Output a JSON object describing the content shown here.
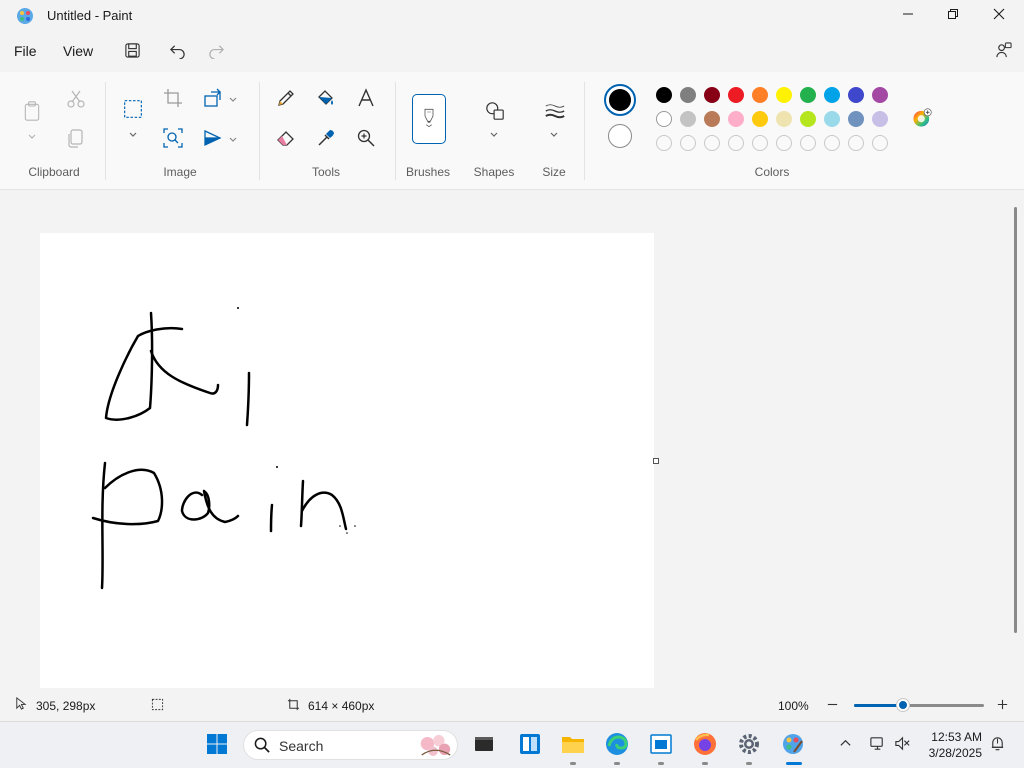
{
  "window": {
    "title": "Untitled - Paint",
    "minimize_icon": "minimize-icon",
    "restore_icon": "restore-icon",
    "close_icon": "close-icon"
  },
  "menu": {
    "file": "File",
    "view": "View",
    "icons": [
      "save-icon",
      "undo-icon",
      "redo-icon",
      "share-icon"
    ]
  },
  "ribbon": {
    "groups": {
      "clipboard": "Clipboard",
      "image": "Image",
      "tools": "Tools",
      "brushes": "Brushes",
      "shapes": "Shapes",
      "size": "Size",
      "colors": "Colors"
    },
    "tools": [
      "paste-icon",
      "cut-icon",
      "copy-icon",
      "select-icon",
      "crop-icon",
      "resize-icon",
      "rotate-icon",
      "image-search-icon",
      "flip-icon",
      "pencil-icon",
      "fill-icon",
      "text-icon",
      "eraser-icon",
      "color-picker-icon",
      "magnifier-icon",
      "brush-icon",
      "shapes-icon",
      "size-icon",
      "edit-colors-icon"
    ]
  },
  "colors": {
    "primary": "#000000",
    "secondary": "#ffffff",
    "palette_row1": [
      "#000000",
      "#7f7f7f",
      "#880015",
      "#ed1c24",
      "#ff7f27",
      "#fff200",
      "#22b14c",
      "#00a2e8",
      "#3f48cc",
      "#a349a4"
    ],
    "palette_row2": [
      "#ffffff",
      "#c3c3c3",
      "#b97a57",
      "#ffaec9",
      "#ffc90e",
      "#efe4b0",
      "#b5e61d",
      "#99d9ea",
      "#7092be",
      "#c8bfe7"
    ]
  },
  "status": {
    "cursor_position": "305, 298px",
    "canvas_size": "614 × 460px",
    "zoom_level": "100%",
    "zoom_fraction": 0.38
  },
  "taskbar": {
    "search_placeholder": "Search",
    "time": "12:53 AM",
    "date": "3/28/2025",
    "apps": [
      "start-icon",
      "search-icon",
      "terminal-icon",
      "widgets-icon",
      "file-explorer-icon",
      "edge-icon",
      "store-icon",
      "firefox-icon",
      "settings-icon",
      "paint-icon"
    ],
    "tray": [
      "chevron-up-icon",
      "network-icon",
      "volume-muted-icon",
      "notification-icon"
    ]
  }
}
